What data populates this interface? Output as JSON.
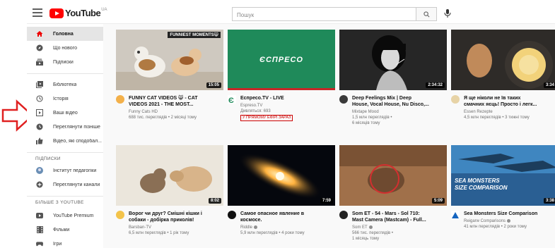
{
  "app": {
    "logo_text": "YouTube",
    "logo_sup": "UA"
  },
  "search": {
    "placeholder": "Пошук",
    "value": ""
  },
  "sidebar": {
    "items": [
      {
        "label": "Головна",
        "icon": "home-icon",
        "active": true
      },
      {
        "label": "Що нового",
        "icon": "explore-icon"
      },
      {
        "label": "Підписки",
        "icon": "subscriptions-icon"
      },
      {
        "label": "Бібліотека",
        "icon": "library-icon"
      },
      {
        "label": "Історія",
        "icon": "history-icon"
      },
      {
        "label": "Ваші відео",
        "icon": "your-videos-icon"
      },
      {
        "label": "Переглянути пізніше",
        "icon": "watch-later-icon"
      },
      {
        "label": "Відео, які сподобал...",
        "icon": "liked-icon"
      }
    ],
    "subscriptions_heading": "ПІДПИСКИ",
    "subscriptions": [
      {
        "label": "Інститут педагогіки",
        "icon": "channel-avatar"
      },
      {
        "label": "Переглянути канали",
        "icon": "add-circle-icon"
      }
    ],
    "more_heading": "БІЛЬШЕ З YOUTUBE",
    "more": [
      {
        "label": "YouTube Premium",
        "icon": "youtube-icon"
      },
      {
        "label": "Фільми",
        "icon": "film-icon"
      },
      {
        "label": "Ігри",
        "icon": "gamepad-icon"
      }
    ]
  },
  "videos": [
    {
      "title1": "FUNNY CAT VIDEOS 😸 - CAT",
      "title2": "VIDEOS 2021 - THE MOST...",
      "channel": "Funny Cats HD",
      "stats1": "688 тис. переглядів • 2 місяці тому",
      "stats2": "",
      "duration": "15:05",
      "thumb_text": "FUNNIEST MOMENTS😸",
      "accent": "#d9c9b5"
    },
    {
      "title1": "Еспресо.TV - LIVE",
      "title2": "",
      "channel": "Espreso.TV",
      "stats1": "Дивляться: 693",
      "stats2": "",
      "live": "У ПРЯМОМУ ЕФІРІ ЗАРАЗ",
      "duration": "",
      "thumb_text": "ЄСПРЕСО",
      "accent": "#1f8a5a"
    },
    {
      "title1": "Deep Feelings Mix | Deep",
      "title2": "House, Vocal House, Nu Disco,...",
      "channel": "Mixtape Mood",
      "stats1": "1,5 млн переглядів •",
      "stats2": "6 місяців тому",
      "duration": "2:34:32",
      "thumb_text": "",
      "accent": "#222222"
    },
    {
      "title1": "Я ще ніколи не їв таких",
      "title2": "смачних яєць! Просто і легк...",
      "channel": "Essen Rezepte",
      "stats1": "4,5 млн переглядів • 3 тижні тому",
      "stats2": "",
      "duration": "3:34",
      "thumb_text": "",
      "accent": "#e8b441"
    },
    {
      "title1": "Ворог чи друг? Смішні кішки і",
      "title2": "собаки - добірка приколів!",
      "channel": "Barsban-TV",
      "stats1": "6,5 млн переглядів • 1 рік тому",
      "stats2": "",
      "duration": "8:02",
      "thumb_text": "",
      "accent": "#e9e4da"
    },
    {
      "title1": "Самое опасное явление в",
      "title2": "космосе.",
      "channel": "Riddle",
      "stats1": "5,9 млн переглядів • 4 роки тому",
      "stats2": "",
      "duration": "7:59",
      "thumb_text": "",
      "accent": "#ff8a1e"
    },
    {
      "title1": "Som ET - 54 - Mars - Sol 710:",
      "title2": "Mast Camera (Mastcam) - Full...",
      "channel": "Som ET",
      "stats1": "566 тис. переглядів •",
      "stats2": "1 місяць тому",
      "duration": "5:09",
      "thumb_text": "",
      "accent": "#8b5a35"
    },
    {
      "title1": "Sea Monsters Size Comparison",
      "title2": "",
      "channel": "Reigarw Comparisons",
      "stats1": "41 млн переглядів • 2 роки тому",
      "stats2": "",
      "duration": "3:38",
      "thumb_text": "SEA MONSTERS\nSIZE COMPARISON",
      "accent": "#2a6ea6"
    }
  ],
  "colors": {
    "brand_red": "#ff0000",
    "arrow_red": "#e02020",
    "live_red": "#cc0000"
  }
}
